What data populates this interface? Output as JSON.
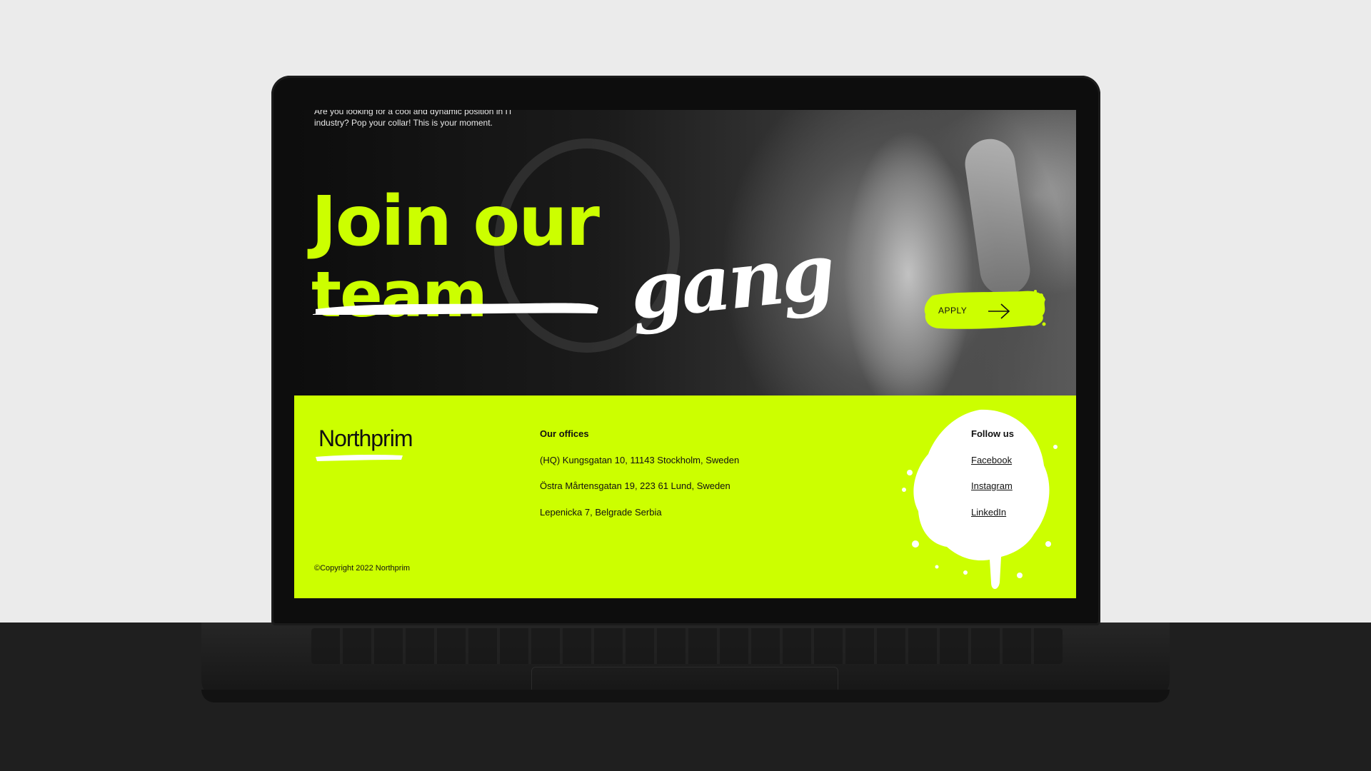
{
  "hero": {
    "intro_text": "Are you looking for a cool and dynamic position in IT industry? Pop your collar! This is your moment.",
    "headline_line1": "Join our",
    "headline_struck": "team",
    "headline_script": "gang",
    "apply_label": "APPLY"
  },
  "footer": {
    "logo": "Northprim",
    "offices_title": "Our offices",
    "offices": [
      "(HQ) Kungsgatan 10, 11143 Stockholm, Sweden",
      "Östra Mårtensgatan 19, 223 61 Lund, Sweden",
      "Lepenicka 7, Belgrade Serbia"
    ],
    "follow_title": "Follow us",
    "social_links": [
      "Facebook",
      "Instagram",
      "LinkedIn"
    ],
    "copyright": "©Copyright 2022 Northprim"
  },
  "colors": {
    "accent": "#ccff00",
    "dark": "#111111",
    "script": "#ffffff"
  },
  "icons": {
    "apply_arrow": "arrow-right-icon"
  }
}
